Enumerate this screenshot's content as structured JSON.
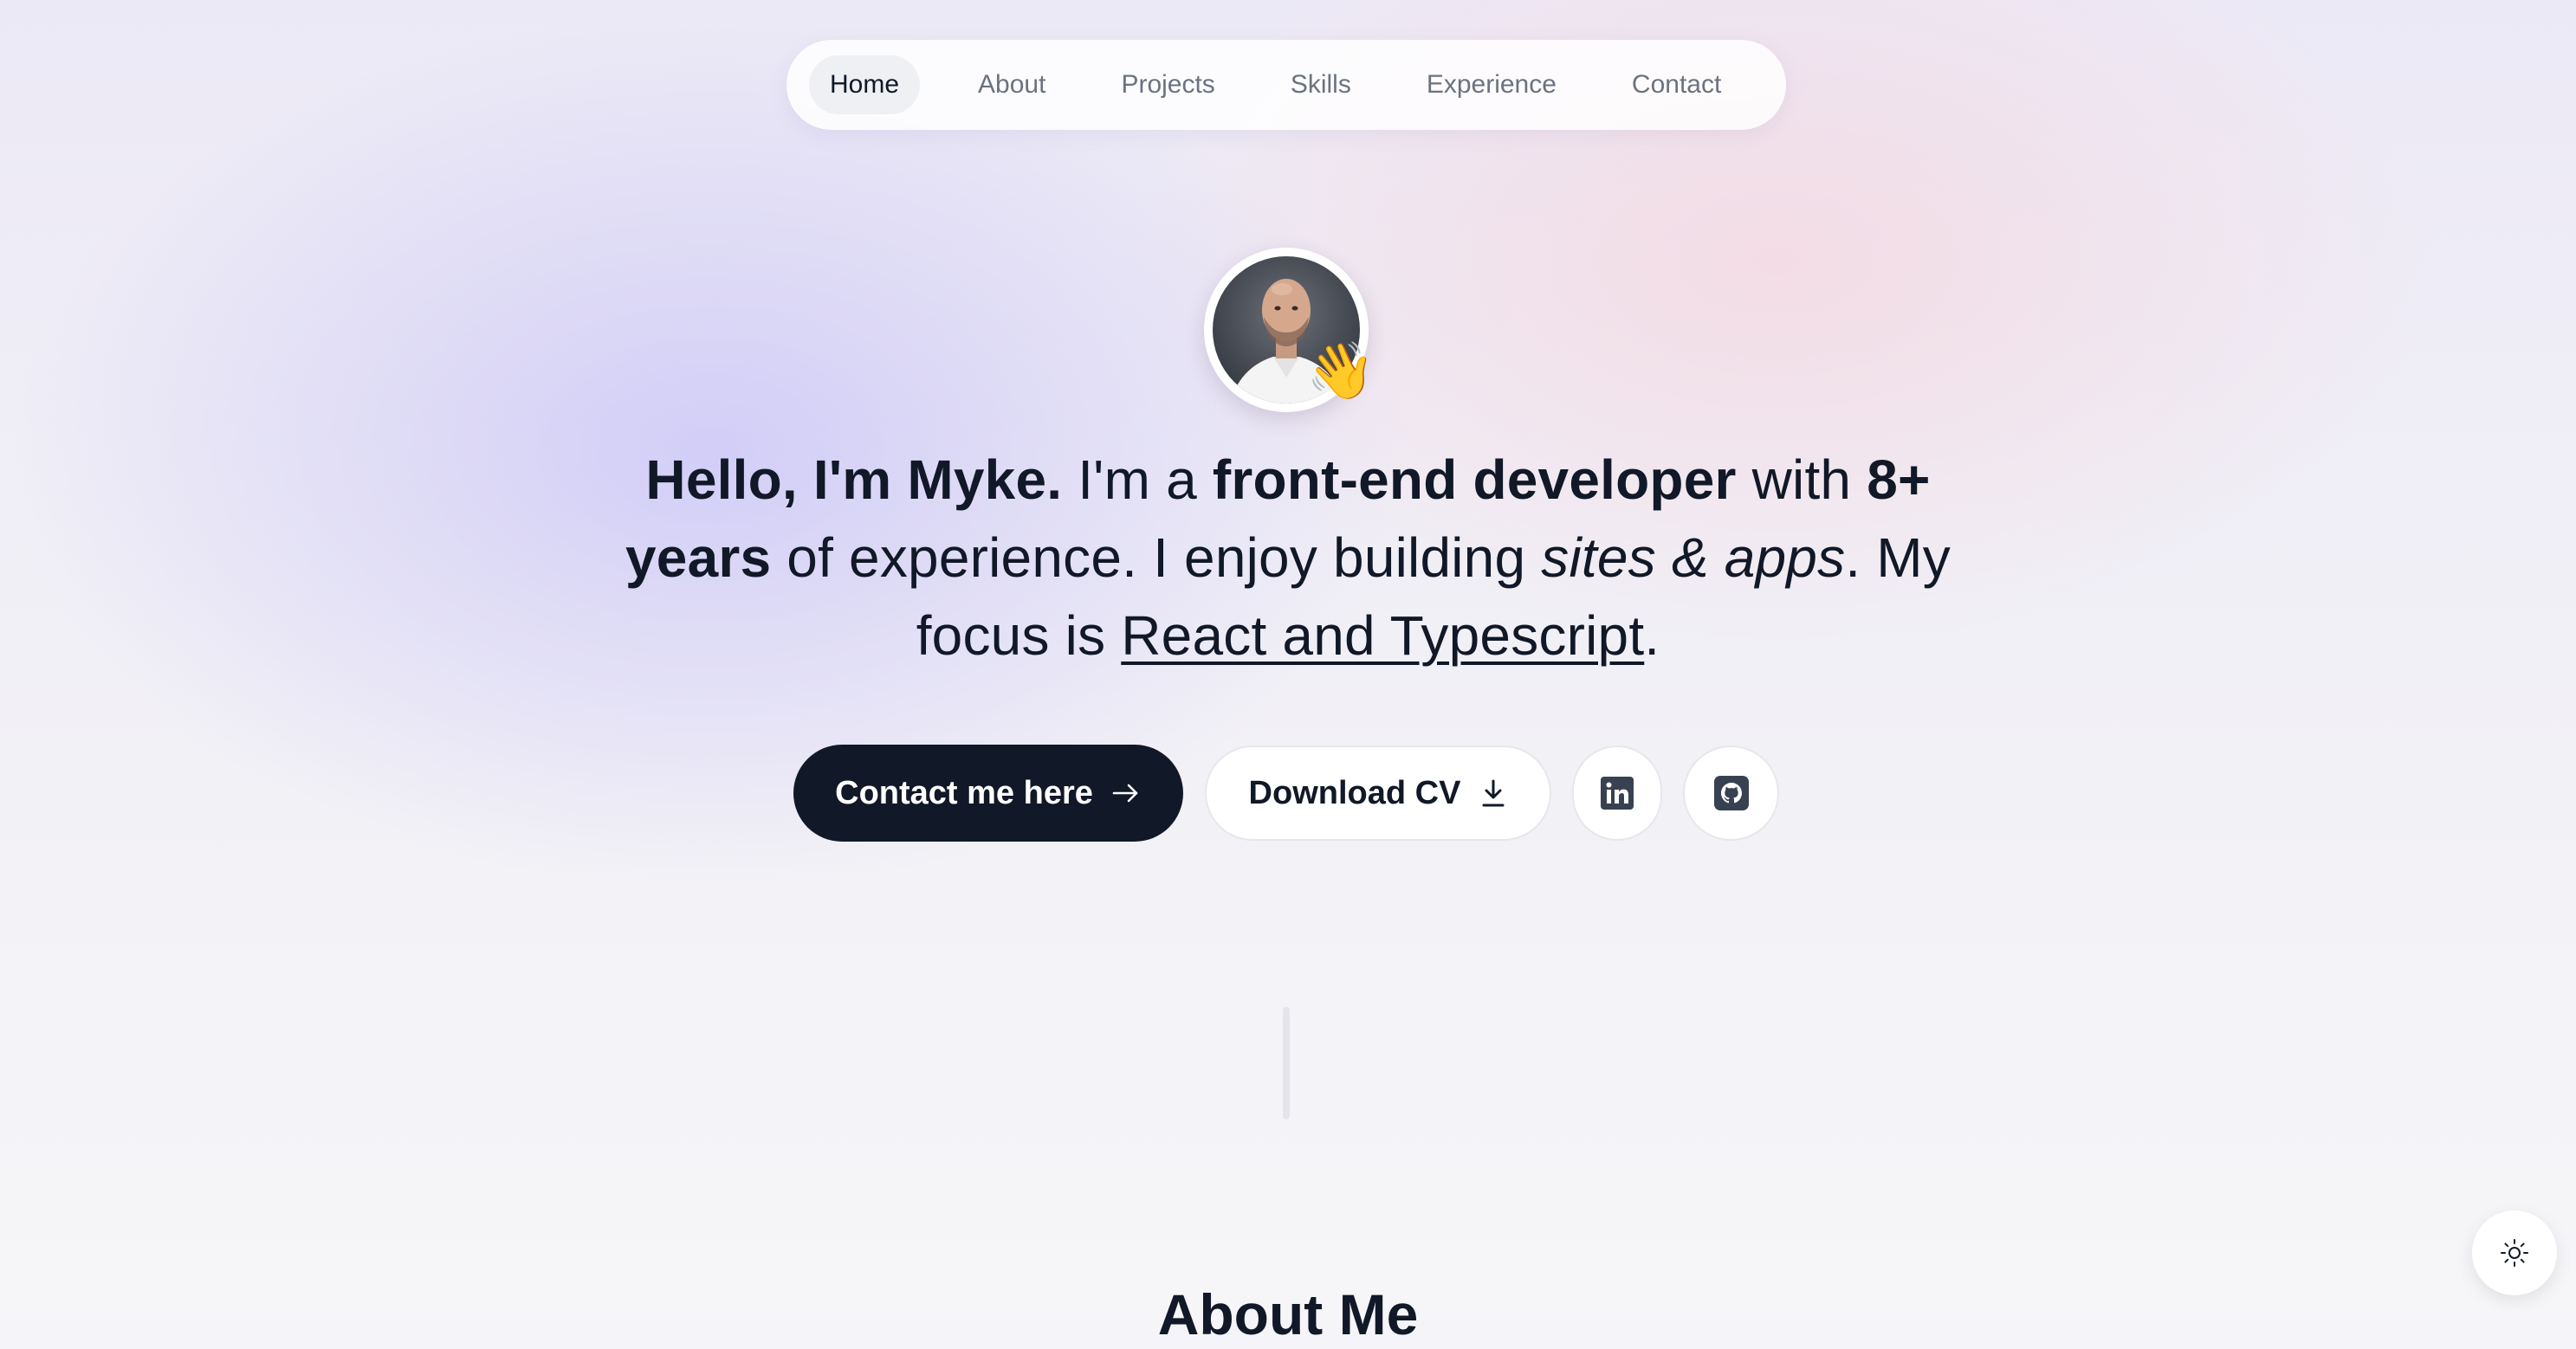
{
  "nav": {
    "items": [
      {
        "label": "Home",
        "active": true
      },
      {
        "label": "About",
        "active": false
      },
      {
        "label": "Projects",
        "active": false
      },
      {
        "label": "Skills",
        "active": false
      },
      {
        "label": "Experience",
        "active": false
      },
      {
        "label": "Contact",
        "active": false
      }
    ]
  },
  "hero": {
    "avatar_icon": "profile-photo",
    "wave_emoji": "👋",
    "greeting": "Hello, I'm Myke.",
    "text_1": " I'm a ",
    "role": "front-end developer",
    "text_2": " with ",
    "years": "8+ years",
    "text_3": " of experience. I enjoy building ",
    "building": "sites & apps",
    "text_4": ". My focus is ",
    "focus": "React and Typescript",
    "text_5": "."
  },
  "actions": {
    "contact_label": "Contact me here",
    "contact_icon": "arrow-right-icon",
    "cv_label": "Download CV",
    "cv_icon": "download-icon",
    "linkedin_icon": "linkedin-icon",
    "github_icon": "github-icon"
  },
  "about": {
    "title": "About Me"
  },
  "theme": {
    "icon": "sun-icon"
  },
  "colors": {
    "primary": "#111827",
    "muted": "#6b7280",
    "background_purple": "#c9c4f7",
    "background_pink": "#f5d6de"
  }
}
